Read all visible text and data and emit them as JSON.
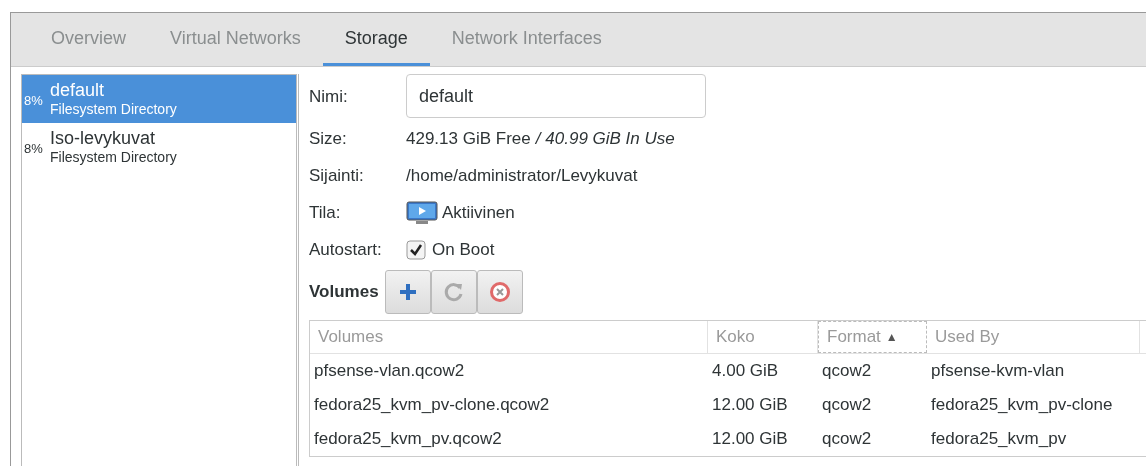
{
  "tabs": [
    {
      "label": "Overview",
      "selected": false
    },
    {
      "label": "Virtual Networks",
      "selected": false
    },
    {
      "label": "Storage",
      "selected": true
    },
    {
      "label": "Network Interfaces",
      "selected": false
    }
  ],
  "pools": [
    {
      "usage": "8%",
      "name": "default",
      "type": "Filesystem Directory",
      "selected": true
    },
    {
      "usage": "8%",
      "name": "Iso-levykuvat",
      "type": "Filesystem Directory",
      "selected": false
    }
  ],
  "details": {
    "name_label": "Nimi:",
    "name_value": "default",
    "size_label": "Size:",
    "size_free": "429.13 GiB Free",
    "size_used": "/ 40.99 GiB In Use",
    "location_label": "Sijainti:",
    "location": "/home/administrator/Levykuvat",
    "state_label": "Tila:",
    "state": "Aktiivinen",
    "autostart_label": "Autostart:",
    "autostart_option": "On Boot",
    "autostart_checked": true
  },
  "volumes": {
    "title": "Volumes",
    "columns": [
      {
        "label": "Volumes"
      },
      {
        "label": "Koko"
      },
      {
        "label": "Format",
        "sort": "▲"
      },
      {
        "label": "Used By"
      }
    ],
    "rows": [
      [
        "pfsense-vlan.qcow2",
        "4.00 GiB",
        "qcow2",
        "pfsense-kvm-vlan"
      ],
      [
        "fedora25_kvm_pv-clone.qcow2",
        "12.00 GiB",
        "qcow2",
        "fedora25_kvm_pv-clone"
      ],
      [
        "fedora25_kvm_pv.qcow2",
        "12.00 GiB",
        "qcow2",
        "fedora25_kvm_pv"
      ]
    ]
  }
}
